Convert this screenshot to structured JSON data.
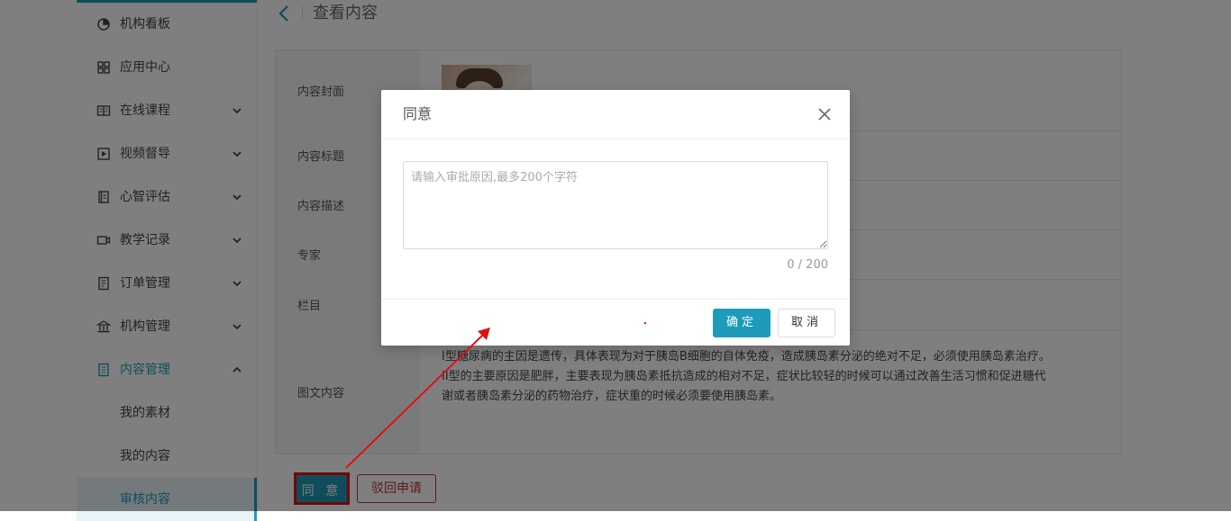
{
  "sidebar": {
    "items": [
      {
        "label": "机构看板",
        "icon": "dashboard-icon",
        "arrow": ""
      },
      {
        "label": "应用中心",
        "icon": "grid-icon",
        "arrow": ""
      },
      {
        "label": "在线课程",
        "icon": "book-icon",
        "arrow": "down"
      },
      {
        "label": "视频督导",
        "icon": "video-icon",
        "arrow": "down"
      },
      {
        "label": "心智评估",
        "icon": "clipboard-icon",
        "arrow": "down"
      },
      {
        "label": "教学记录",
        "icon": "camera-icon",
        "arrow": "down"
      },
      {
        "label": "订单管理",
        "icon": "order-icon",
        "arrow": "down"
      },
      {
        "label": "机构管理",
        "icon": "building-icon",
        "arrow": "down"
      },
      {
        "label": "内容管理",
        "icon": "content-icon",
        "arrow": "up",
        "active": true
      }
    ],
    "sub_items": [
      {
        "label": "我的素材"
      },
      {
        "label": "我的内容"
      },
      {
        "label": "审核内容",
        "selected": true
      }
    ],
    "accent_color": "#1e9bb8"
  },
  "header": {
    "back_icon": "chevron-left-icon",
    "title": "查看内容"
  },
  "detail": {
    "rows": [
      {
        "label": "内容封面"
      },
      {
        "label": "内容标题"
      },
      {
        "label": "内容描述"
      },
      {
        "label": "专家"
      },
      {
        "label": "栏目"
      },
      {
        "label": "图文内容"
      }
    ],
    "article_lines": [
      "I型糖尿病的主因是遗传，具体表现为对于胰岛B细胞的自体免疫，造成胰岛素分泌的绝对不足，必须使用胰岛素治疗。",
      "II型的主要原因是肥胖，主要表现为胰岛素抵抗造成的相对不足，症状比较轻的时候可以通过改善生活习惯和促进糖代",
      "谢或者胰岛素分泌的药物治疗，症状重的时候必须要使用胰岛素。"
    ]
  },
  "actions": {
    "agree_label": "同 意",
    "reject_label": "驳回申请"
  },
  "modal": {
    "title": "同意",
    "close_icon": "close-icon",
    "textarea_placeholder": "请输入审批原因,最多200个字符",
    "textarea_value": "",
    "char_count": "0 / 200",
    "ok_label": "确定",
    "cancel_label": "取消"
  },
  "colors": {
    "primary": "#1e9bb8",
    "danger": "#c0312d",
    "annotation": "#e01010"
  }
}
